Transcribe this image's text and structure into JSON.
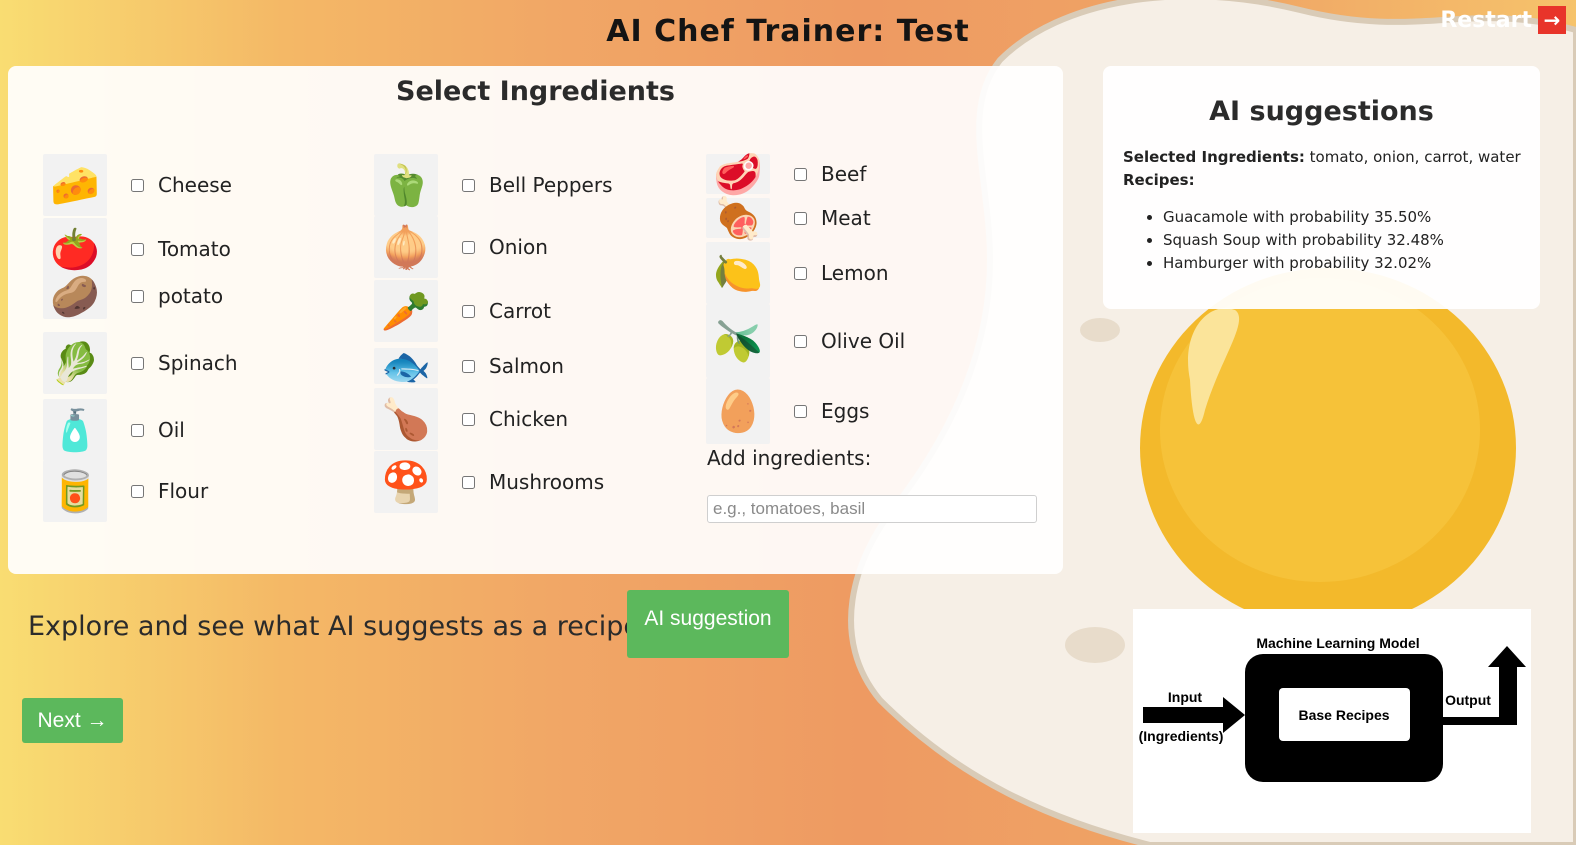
{
  "header": {
    "title": "AI Chef Trainer: Test",
    "restart_label": "Restart",
    "restart_arrow": "→"
  },
  "ingredients_panel": {
    "title": "Select Ingredients",
    "columns": [
      [
        {
          "label": "Cheese",
          "icon": "cheese-icon",
          "glyph": "🧀"
        },
        {
          "label": "Tomato",
          "icon": "tomato-icon",
          "glyph": "🍅"
        },
        {
          "label": "potato",
          "icon": "potato-icon",
          "glyph": "🥔"
        },
        {
          "label": "Spinach",
          "icon": "spinach-icon",
          "glyph": "🥬"
        },
        {
          "label": "Oil",
          "icon": "oil-bottle-icon",
          "glyph": "🧴"
        },
        {
          "label": "Flour",
          "icon": "flour-bag-icon",
          "glyph": "🥫"
        }
      ],
      [
        {
          "label": "Bell Peppers",
          "icon": "bell-pepper-icon",
          "glyph": "🫑"
        },
        {
          "label": "Onion",
          "icon": "onion-icon",
          "glyph": "🧅"
        },
        {
          "label": "Carrot",
          "icon": "carrot-icon",
          "glyph": "🥕"
        },
        {
          "label": "Salmon",
          "icon": "salmon-icon",
          "glyph": "🐟"
        },
        {
          "label": "Chicken",
          "icon": "chicken-icon",
          "glyph": "🍗"
        },
        {
          "label": "Mushrooms",
          "icon": "mushroom-icon",
          "glyph": "🍄"
        }
      ],
      [
        {
          "label": "Beef",
          "icon": "beef-icon",
          "glyph": "🥩"
        },
        {
          "label": "Meat",
          "icon": "meat-icon",
          "glyph": "🍖"
        },
        {
          "label": "Lemon",
          "icon": "lemon-icon",
          "glyph": "🍋"
        },
        {
          "label": "Olive Oil",
          "icon": "olive-oil-icon",
          "glyph": "🫒"
        },
        {
          "label": "Eggs",
          "icon": "eggs-icon",
          "glyph": "🥚"
        }
      ]
    ],
    "add_label": "Add ingredients:",
    "add_placeholder": "e.g., tomatoes, basil"
  },
  "explore_text": "Explore and see what AI suggests as a recipe",
  "ai_button_label": "AI suggestion",
  "next_button_label": "Next →",
  "ai_panel": {
    "title": "AI suggestions",
    "selected_label": "Selected Ingredients:",
    "selected_value": "tomato, onion, carrot, water",
    "recipes_label": "Recipes:",
    "recipes": [
      "Guacamole with probability 35.50%",
      "Squash Soup with probability 32.48%",
      "Hamburger with probability 32.02%"
    ]
  },
  "diagram": {
    "model_label": "Machine Learning Model",
    "input_label": "Input",
    "input_sub": "(Ingredients)",
    "inner_label": "Base Recipes",
    "output_label": "Output"
  },
  "colors": {
    "green_button": "#5cb85c",
    "restart_red": "#e8342a",
    "egg_yolk": "#f3b92b"
  }
}
